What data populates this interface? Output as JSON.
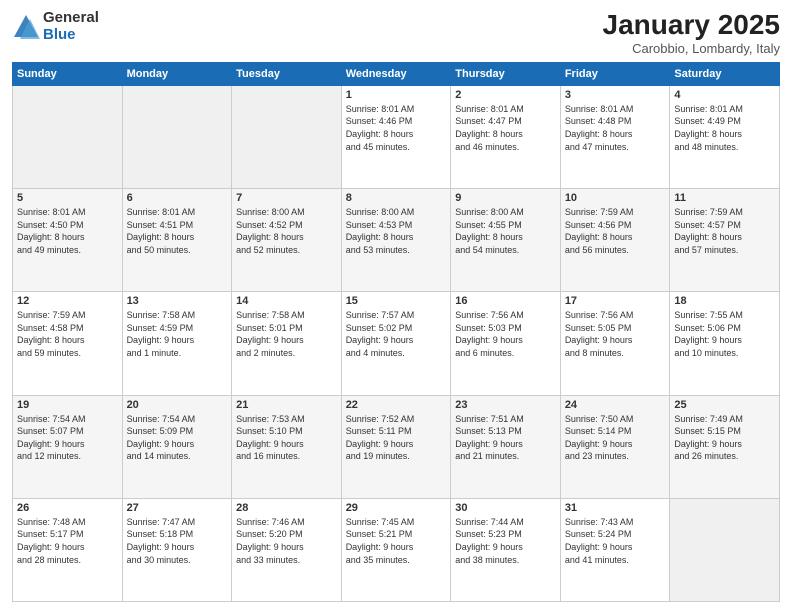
{
  "logo": {
    "general": "General",
    "blue": "Blue"
  },
  "title": "January 2025",
  "location": "Carobbio, Lombardy, Italy",
  "days_header": [
    "Sunday",
    "Monday",
    "Tuesday",
    "Wednesday",
    "Thursday",
    "Friday",
    "Saturday"
  ],
  "weeks": [
    [
      {
        "num": "",
        "info": ""
      },
      {
        "num": "",
        "info": ""
      },
      {
        "num": "",
        "info": ""
      },
      {
        "num": "1",
        "info": "Sunrise: 8:01 AM\nSunset: 4:46 PM\nDaylight: 8 hours\nand 45 minutes."
      },
      {
        "num": "2",
        "info": "Sunrise: 8:01 AM\nSunset: 4:47 PM\nDaylight: 8 hours\nand 46 minutes."
      },
      {
        "num": "3",
        "info": "Sunrise: 8:01 AM\nSunset: 4:48 PM\nDaylight: 8 hours\nand 47 minutes."
      },
      {
        "num": "4",
        "info": "Sunrise: 8:01 AM\nSunset: 4:49 PM\nDaylight: 8 hours\nand 48 minutes."
      }
    ],
    [
      {
        "num": "5",
        "info": "Sunrise: 8:01 AM\nSunset: 4:50 PM\nDaylight: 8 hours\nand 49 minutes."
      },
      {
        "num": "6",
        "info": "Sunrise: 8:01 AM\nSunset: 4:51 PM\nDaylight: 8 hours\nand 50 minutes."
      },
      {
        "num": "7",
        "info": "Sunrise: 8:00 AM\nSunset: 4:52 PM\nDaylight: 8 hours\nand 52 minutes."
      },
      {
        "num": "8",
        "info": "Sunrise: 8:00 AM\nSunset: 4:53 PM\nDaylight: 8 hours\nand 53 minutes."
      },
      {
        "num": "9",
        "info": "Sunrise: 8:00 AM\nSunset: 4:55 PM\nDaylight: 8 hours\nand 54 minutes."
      },
      {
        "num": "10",
        "info": "Sunrise: 7:59 AM\nSunset: 4:56 PM\nDaylight: 8 hours\nand 56 minutes."
      },
      {
        "num": "11",
        "info": "Sunrise: 7:59 AM\nSunset: 4:57 PM\nDaylight: 8 hours\nand 57 minutes."
      }
    ],
    [
      {
        "num": "12",
        "info": "Sunrise: 7:59 AM\nSunset: 4:58 PM\nDaylight: 8 hours\nand 59 minutes."
      },
      {
        "num": "13",
        "info": "Sunrise: 7:58 AM\nSunset: 4:59 PM\nDaylight: 9 hours\nand 1 minute."
      },
      {
        "num": "14",
        "info": "Sunrise: 7:58 AM\nSunset: 5:01 PM\nDaylight: 9 hours\nand 2 minutes."
      },
      {
        "num": "15",
        "info": "Sunrise: 7:57 AM\nSunset: 5:02 PM\nDaylight: 9 hours\nand 4 minutes."
      },
      {
        "num": "16",
        "info": "Sunrise: 7:56 AM\nSunset: 5:03 PM\nDaylight: 9 hours\nand 6 minutes."
      },
      {
        "num": "17",
        "info": "Sunrise: 7:56 AM\nSunset: 5:05 PM\nDaylight: 9 hours\nand 8 minutes."
      },
      {
        "num": "18",
        "info": "Sunrise: 7:55 AM\nSunset: 5:06 PM\nDaylight: 9 hours\nand 10 minutes."
      }
    ],
    [
      {
        "num": "19",
        "info": "Sunrise: 7:54 AM\nSunset: 5:07 PM\nDaylight: 9 hours\nand 12 minutes."
      },
      {
        "num": "20",
        "info": "Sunrise: 7:54 AM\nSunset: 5:09 PM\nDaylight: 9 hours\nand 14 minutes."
      },
      {
        "num": "21",
        "info": "Sunrise: 7:53 AM\nSunset: 5:10 PM\nDaylight: 9 hours\nand 16 minutes."
      },
      {
        "num": "22",
        "info": "Sunrise: 7:52 AM\nSunset: 5:11 PM\nDaylight: 9 hours\nand 19 minutes."
      },
      {
        "num": "23",
        "info": "Sunrise: 7:51 AM\nSunset: 5:13 PM\nDaylight: 9 hours\nand 21 minutes."
      },
      {
        "num": "24",
        "info": "Sunrise: 7:50 AM\nSunset: 5:14 PM\nDaylight: 9 hours\nand 23 minutes."
      },
      {
        "num": "25",
        "info": "Sunrise: 7:49 AM\nSunset: 5:15 PM\nDaylight: 9 hours\nand 26 minutes."
      }
    ],
    [
      {
        "num": "26",
        "info": "Sunrise: 7:48 AM\nSunset: 5:17 PM\nDaylight: 9 hours\nand 28 minutes."
      },
      {
        "num": "27",
        "info": "Sunrise: 7:47 AM\nSunset: 5:18 PM\nDaylight: 9 hours\nand 30 minutes."
      },
      {
        "num": "28",
        "info": "Sunrise: 7:46 AM\nSunset: 5:20 PM\nDaylight: 9 hours\nand 33 minutes."
      },
      {
        "num": "29",
        "info": "Sunrise: 7:45 AM\nSunset: 5:21 PM\nDaylight: 9 hours\nand 35 minutes."
      },
      {
        "num": "30",
        "info": "Sunrise: 7:44 AM\nSunset: 5:23 PM\nDaylight: 9 hours\nand 38 minutes."
      },
      {
        "num": "31",
        "info": "Sunrise: 7:43 AM\nSunset: 5:24 PM\nDaylight: 9 hours\nand 41 minutes."
      },
      {
        "num": "",
        "info": ""
      }
    ]
  ]
}
